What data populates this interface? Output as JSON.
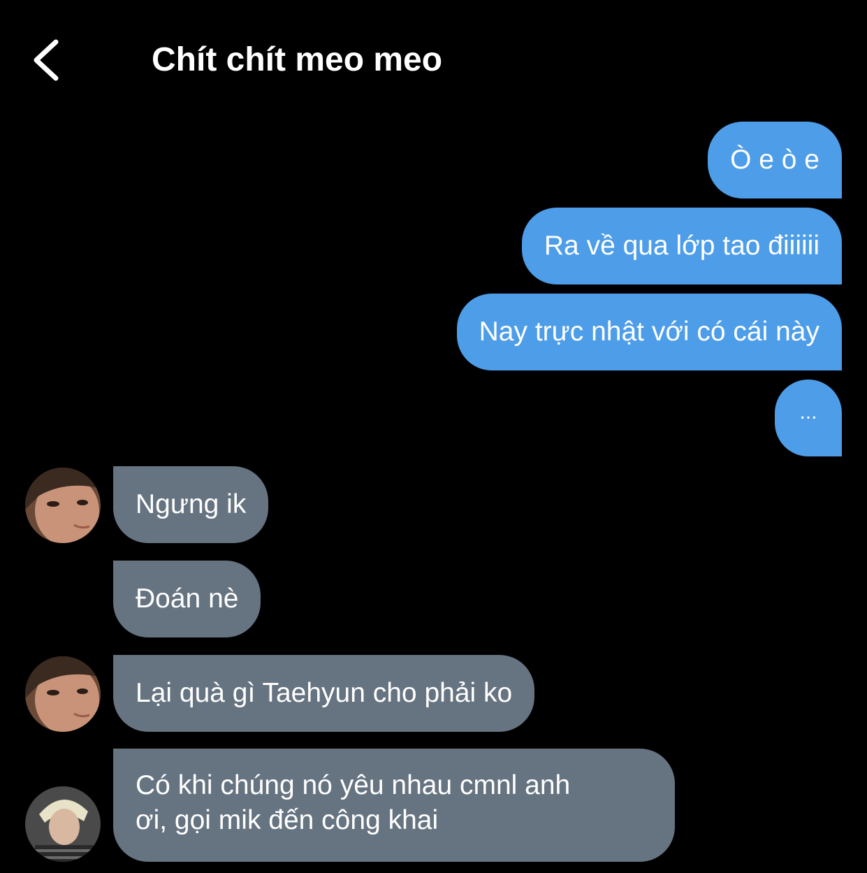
{
  "header": {
    "title": "Chít chít meo meo",
    "back_icon": "chevron-left-icon"
  },
  "colors": {
    "background": "#000000",
    "sent_bubble": "#4d9de8",
    "received_bubble": "#667380",
    "text": "#ffffff"
  },
  "messages": {
    "sent": [
      {
        "text": "Ò e ò e"
      },
      {
        "text": "Ra về qua lớp tao điiiiii"
      },
      {
        "text": "Nay trực nhật với có cái này"
      },
      {
        "text": "..."
      }
    ],
    "received": [
      {
        "text": "Ngưng ik"
      },
      {
        "text": "Đoán nè"
      },
      {
        "text": "Lại quà gì Taehyun cho phải ko"
      },
      {
        "line1": "Có khi chúng nó yêu nhau cmnl anh",
        "line2": "ơi, gọi mik đến công khai"
      }
    ]
  }
}
